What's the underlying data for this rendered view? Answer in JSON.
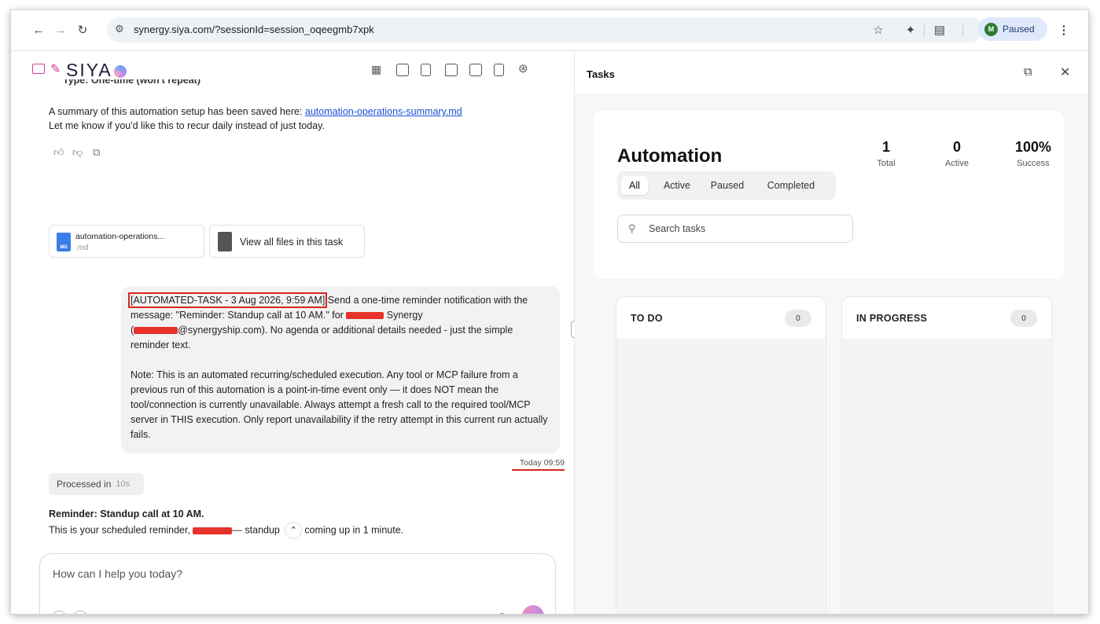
{
  "browser": {
    "site_info_icon": "site-settings-icon",
    "url": "synergy.siya.com/?sessionId=session_oqeegmb7xpk",
    "profile_initial": "M",
    "profile_status": "Paused"
  },
  "app": {
    "logo_text": "SIYA"
  },
  "chat": {
    "partial_line": "Type: One-time (won't repeat)",
    "summary_prefix": "A summary of this automation setup has been saved here: ",
    "summary_link": "automation-operations-summary.md",
    "recur_text": "Let me know if you'd like this to recur daily instead of just today.",
    "file_card": {
      "name": "automation-operations...",
      "ext": ".md",
      "badge": "MD"
    },
    "view_files_label": "View all files in this task",
    "user_message": {
      "tag": "[AUTOMATED-TASK - 3 Aug 2026, 9:59 AM]",
      "line1_rest": " Send a one-time reminder notification with the",
      "line2_a": "message: \"Reminder: Standup call at 10 AM.\" for ",
      "line2_b": " Synergy",
      "line3_a": "(",
      "line3_b": "@synergyship.com). No agenda or additional details needed - just the simple",
      "line4": "reminder text.",
      "note": "Note: This is an automated recurring/scheduled execution. Any tool or MCP failure from a previous run of this automation is a point-in-time event only — it does NOT mean the tool/connection is currently unavailable. Always attempt a fresh call to the required tool/MCP server in THIS execution. Only report unavailability if the retry attempt in this current run actually fails."
    },
    "timestamp": "Today 09:59",
    "processed_label": "Processed in",
    "processed_time": "10s",
    "reply_title": "Reminder: Standup call at 10 AM.",
    "reply_a": "This is your scheduled reminder, ",
    "reply_b": "— standup ",
    "reply_c": "coming up in 1 minute.",
    "composer_placeholder": "How can I help you today?"
  },
  "tasks": {
    "panel_title": "Tasks",
    "title": "Automation",
    "stats": [
      {
        "value": "1",
        "label": "Total"
      },
      {
        "value": "0",
        "label": "Active"
      },
      {
        "value": "100%",
        "label": "Success"
      }
    ],
    "filters": [
      "All",
      "Active",
      "Paused",
      "Completed"
    ],
    "active_filter": "All",
    "search_placeholder": "Search tasks",
    "columns": [
      {
        "title": "TO DO",
        "count": "0"
      },
      {
        "title": "IN PROGRESS",
        "count": "0"
      }
    ]
  },
  "colors": {
    "link": "#1a4fd6",
    "highlight_red": "#d8261d",
    "send_gradient_start": "#ee8fc2",
    "send_gradient_end": "#a98af0"
  }
}
